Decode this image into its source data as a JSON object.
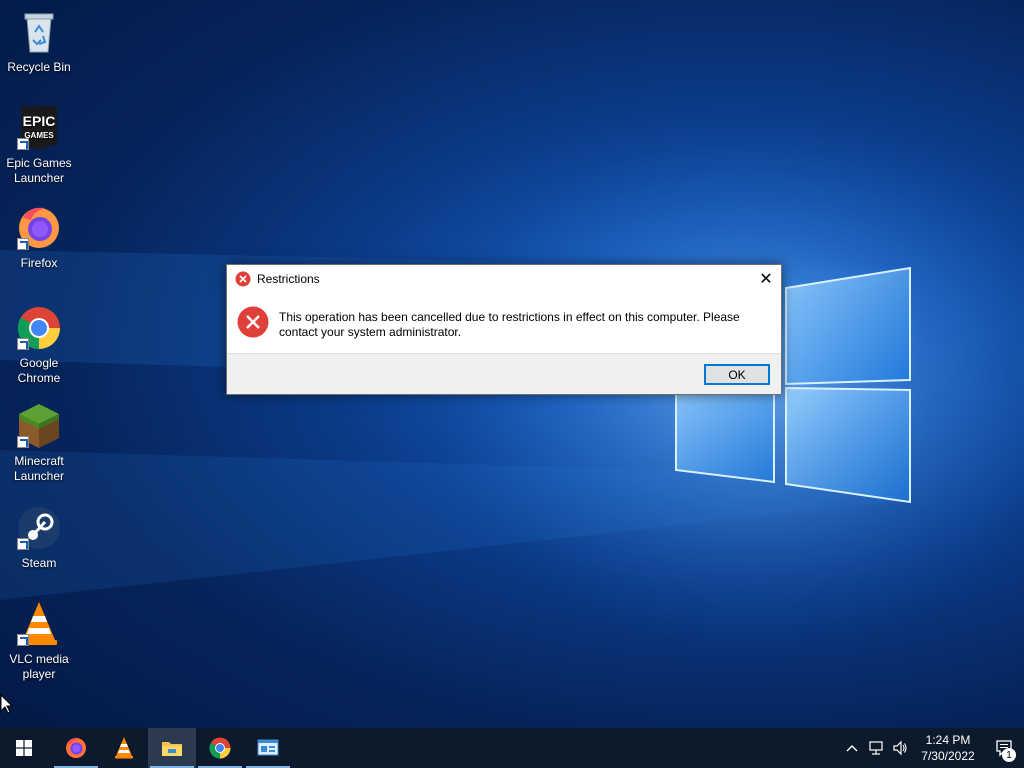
{
  "desktop": {
    "icons": [
      {
        "label": "Recycle Bin",
        "icon": "recycle-bin-icon"
      },
      {
        "label": "Epic Games Launcher",
        "icon": "epic-games-icon"
      },
      {
        "label": "Firefox",
        "icon": "firefox-icon"
      },
      {
        "label": "Google Chrome",
        "icon": "chrome-icon"
      },
      {
        "label": "Minecraft Launcher",
        "icon": "minecraft-icon"
      },
      {
        "label": "Steam",
        "icon": "steam-icon"
      },
      {
        "label": "VLC media player",
        "icon": "vlc-icon"
      }
    ],
    "epic_logo_text": "EPIC",
    "epic_logo_subtext": "GAMES"
  },
  "dialog": {
    "title": "Restrictions",
    "message": "This operation has been cancelled due to restrictions in effect on this computer. Please contact your system administrator.",
    "ok_label": "OK",
    "close_glyph": "✕"
  },
  "taskbar": {
    "apps": [
      {
        "name": "Firefox",
        "icon": "firefox-icon",
        "active": false
      },
      {
        "name": "VLC media player",
        "icon": "vlc-icon",
        "active": false
      },
      {
        "name": "File Explorer",
        "icon": "file-explorer-icon",
        "active": true
      },
      {
        "name": "Google Chrome",
        "icon": "chrome-icon",
        "active": false
      },
      {
        "name": "Control Panel",
        "icon": "control-panel-icon",
        "active": false
      }
    ],
    "clock": {
      "time": "1:24 PM",
      "date": "7/30/2022"
    },
    "notification_count": "1"
  },
  "colors": {
    "accent": "#0078d7",
    "error_red": "#e0403a",
    "taskbar_bg": "#0c1a2c"
  }
}
